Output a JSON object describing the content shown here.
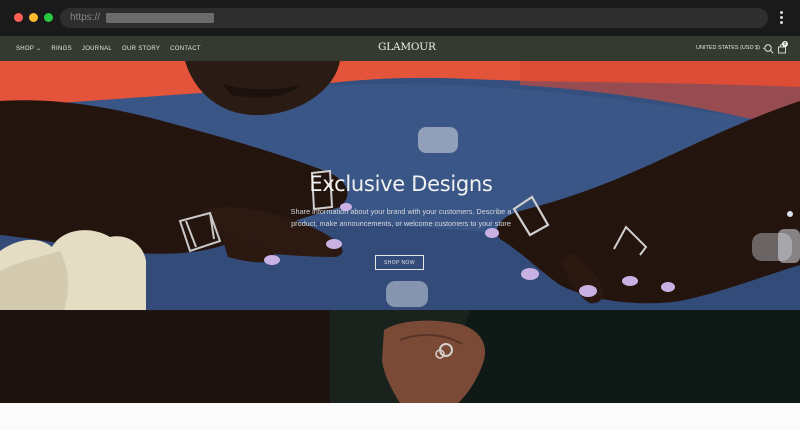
{
  "browser": {
    "url_prefix": "https://"
  },
  "header": {
    "nav": [
      {
        "label": "SHOP ⌄"
      },
      {
        "label": "RINGS"
      },
      {
        "label": "JOURNAL"
      },
      {
        "label": "OUR STORY"
      },
      {
        "label": "CONTACT"
      }
    ],
    "logo": "GLAMOUR",
    "currency": "UNITED STATES (USD $) ⌄",
    "cart_count": "0"
  },
  "hero": {
    "title": "Exclusive Designs",
    "description": "Share information about your brand with your customers. Describe a product, make announcements, or welcome customers to your store",
    "button_label": "SHOP NOW"
  },
  "colors": {
    "header_bg": "#343a2f",
    "hero_blue": "#35507f",
    "accent_coral": "#e4543a"
  }
}
